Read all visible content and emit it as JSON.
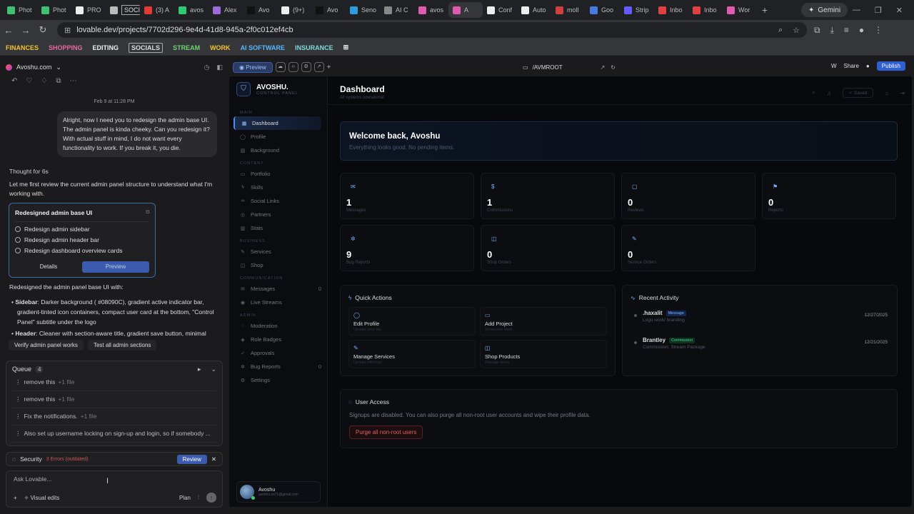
{
  "browser": {
    "tabs": [
      {
        "label": "Phot",
        "color": "#3fbf70"
      },
      {
        "label": "Phot",
        "color": "#3fbf70"
      },
      {
        "label": "PRO",
        "color": "#eeeeee"
      },
      {
        "label": "SOCIALS",
        "color": "#bbbbbb",
        "boxed": true
      },
      {
        "label": "(3) A",
        "color": "#e53935"
      },
      {
        "label": "avos",
        "color": "#2ecc71"
      },
      {
        "label": "Alex",
        "color": "#9b6bd8"
      },
      {
        "label": "Avo",
        "color": "#111111"
      },
      {
        "label": "(9+)",
        "color": "#eeeeee"
      },
      {
        "label": "Avo",
        "color": "#111111"
      },
      {
        "label": "Seno",
        "color": "#2c9cdb"
      },
      {
        "label": "AI C",
        "color": "#888888"
      },
      {
        "label": "avos",
        "color": "#e05ab0"
      },
      {
        "label": "A",
        "color": "#e05ab0",
        "active": true
      },
      {
        "label": "Conf",
        "color": "#eeeeee"
      },
      {
        "label": "Auto",
        "color": "#eeeeee"
      },
      {
        "label": "moll",
        "color": "#d04040"
      },
      {
        "label": "Goo",
        "color": "#4a7ae0"
      },
      {
        "label": "Strip",
        "color": "#635bff"
      },
      {
        "label": "Inbo",
        "color": "#e04040"
      },
      {
        "label": "Inbo",
        "color": "#e04040"
      },
      {
        "label": "Wor",
        "color": "#e05ab0"
      }
    ],
    "new_tab": "+",
    "gemini": "Gemini",
    "url": "lovable.dev/projects/7702d296-9e4d-41d8-945a-2f0c012ef4cb",
    "bookmarks": [
      {
        "label": "FINANCES",
        "style": "yellow"
      },
      {
        "label": "SHOPPING",
        "style": "pink"
      },
      {
        "label": "EDITING",
        "style": "white"
      },
      {
        "label": "SOCIALS",
        "style": "boxed"
      },
      {
        "label": "STREAM",
        "style": "green"
      },
      {
        "label": "WORK",
        "style": "yellow"
      },
      {
        "label": "AI SOFTWARE",
        "style": "blue"
      },
      {
        "label": "INSURANCE",
        "style": "cyan"
      }
    ]
  },
  "chat": {
    "project_name": "Avoshu.com",
    "timestamp": "Feb 9 at 11:28 PM",
    "user_message": "Alright, now I need you to redesign the admin base UI. The admin panel is kinda cheeky. Can you redesign it? With actual stuff in mind, I do not want every functionality to work. If you break it, you die.",
    "thought": "Thought for 6s",
    "intro": "Let me first review the current admin panel structure to understand what I'm working with.",
    "card": {
      "title": "Redesigned admin base UI",
      "items": [
        "Redesign admin sidebar",
        "Redesign admin header bar",
        "Redesign dashboard overview cards"
      ],
      "details": "Details",
      "preview": "Preview"
    },
    "summary": "Redesigned the admin panel base UI with:",
    "bullets": [
      {
        "head": "Sidebar",
        "text": ": Darker background ( #08090C), gradient active indicator bar, gradient-tinted icon containers, compact user card at the bottom, \"Control Panel\" subtitle under the logo"
      },
      {
        "head": "Header",
        "text": ": Cleaner with section-aware title, gradient save button, minimal"
      }
    ],
    "suggestions": [
      "Verify admin panel works",
      "Test all admin sections"
    ],
    "queue": {
      "label": "Queue",
      "count": "4",
      "items": [
        {
          "text": "remove this",
          "files": "+1 file"
        },
        {
          "text": "remove this",
          "files": "+1 file"
        },
        {
          "text": "Fix the notifications.",
          "files": "+1 file"
        },
        {
          "text": "Also set up username locking on sign-up and login, so if somebody ...",
          "files": ""
        }
      ]
    },
    "security": {
      "label": "Security",
      "errors": "3 Errors (outdated)",
      "review": "Review"
    },
    "input": {
      "placeholder": "Ask Lovable...",
      "visual_edits": "Visual edits",
      "plan": "Plan"
    }
  },
  "preview_bar": {
    "preview": "Preview",
    "path": "/AVMROOT",
    "share": "Share",
    "publish": "Publish"
  },
  "app": {
    "brand": {
      "name": "AVOSHU.",
      "sub": "CONTROL PANEL"
    },
    "nav": [
      {
        "section": "MAIN"
      },
      {
        "label": "Dashboard",
        "icon": "grid",
        "active": true
      },
      {
        "label": "Profile",
        "icon": "user"
      },
      {
        "label": "Background",
        "icon": "image"
      },
      {
        "section": "CONTENT"
      },
      {
        "label": "Portfolio",
        "icon": "folder"
      },
      {
        "label": "Skills",
        "icon": "bolt"
      },
      {
        "label": "Social Links",
        "icon": "link"
      },
      {
        "label": "Partners",
        "icon": "users"
      },
      {
        "label": "Stats",
        "icon": "chart"
      },
      {
        "section": "BUSINESS"
      },
      {
        "label": "Services",
        "icon": "wrench"
      },
      {
        "label": "Shop",
        "icon": "bag"
      },
      {
        "section": "COMMUNICATION"
      },
      {
        "label": "Messages",
        "icon": "mail",
        "count": "0"
      },
      {
        "label": "Live Streams",
        "icon": "radio"
      },
      {
        "section": "ADMIN"
      },
      {
        "label": "Moderation",
        "icon": "shield"
      },
      {
        "label": "Role Badges",
        "icon": "badge"
      },
      {
        "label": "Approvals",
        "icon": "check"
      },
      {
        "label": "Bug Reports",
        "icon": "bug",
        "count": "0"
      },
      {
        "label": "Settings",
        "icon": "gear"
      }
    ],
    "user": {
      "name": "Avoshu",
      "email": "avoshu.xs71@gmail.com"
    },
    "header": {
      "title": "Dashboard",
      "subtitle": "All systems operational",
      "saved": "Saved"
    },
    "welcome": {
      "title": "Welcome back, Avoshu",
      "text": "Everything looks good. No pending items."
    },
    "stats": [
      {
        "value": "1",
        "label": "Messages",
        "icon": "mail"
      },
      {
        "value": "1",
        "label": "Commissions",
        "icon": "dollar"
      },
      {
        "value": "0",
        "label": "Reviews",
        "icon": "chat"
      },
      {
        "value": "0",
        "label": "Reports",
        "icon": "flag"
      },
      {
        "value": "9",
        "label": "Bug Reports",
        "icon": "bug"
      },
      {
        "value": "0",
        "label": "Shop Orders",
        "icon": "bag"
      },
      {
        "value": "0",
        "label": "Service Orders",
        "icon": "wrench"
      }
    ],
    "quick_actions": {
      "title": "Quick Actions",
      "items": [
        {
          "title": "Edit Profile",
          "sub": "Update your bio",
          "icon": "user"
        },
        {
          "title": "Add Project",
          "sub": "Showcase work",
          "icon": "folder"
        },
        {
          "title": "Manage Services",
          "sub": "Update offerings",
          "icon": "wrench"
        },
        {
          "title": "Shop Products",
          "sub": "Manage items",
          "icon": "bag"
        }
      ]
    },
    "recent_activity": {
      "title": "Recent Activity",
      "items": [
        {
          "name": ".haxalit",
          "badge": "Message",
          "badge_type": "msg",
          "desc": "Logo work/ branding",
          "date": "12/27/2025"
        },
        {
          "name": "Brantley",
          "badge": "Commission",
          "badge_type": "com",
          "desc": "Commission: Stream Package",
          "date": "12/21/2025"
        }
      ]
    },
    "user_access": {
      "title": "User Access",
      "text": "Signups are disabled. You can also purge all non-root user accounts and wipe their profile data.",
      "button": "Purge all non-root users"
    }
  }
}
